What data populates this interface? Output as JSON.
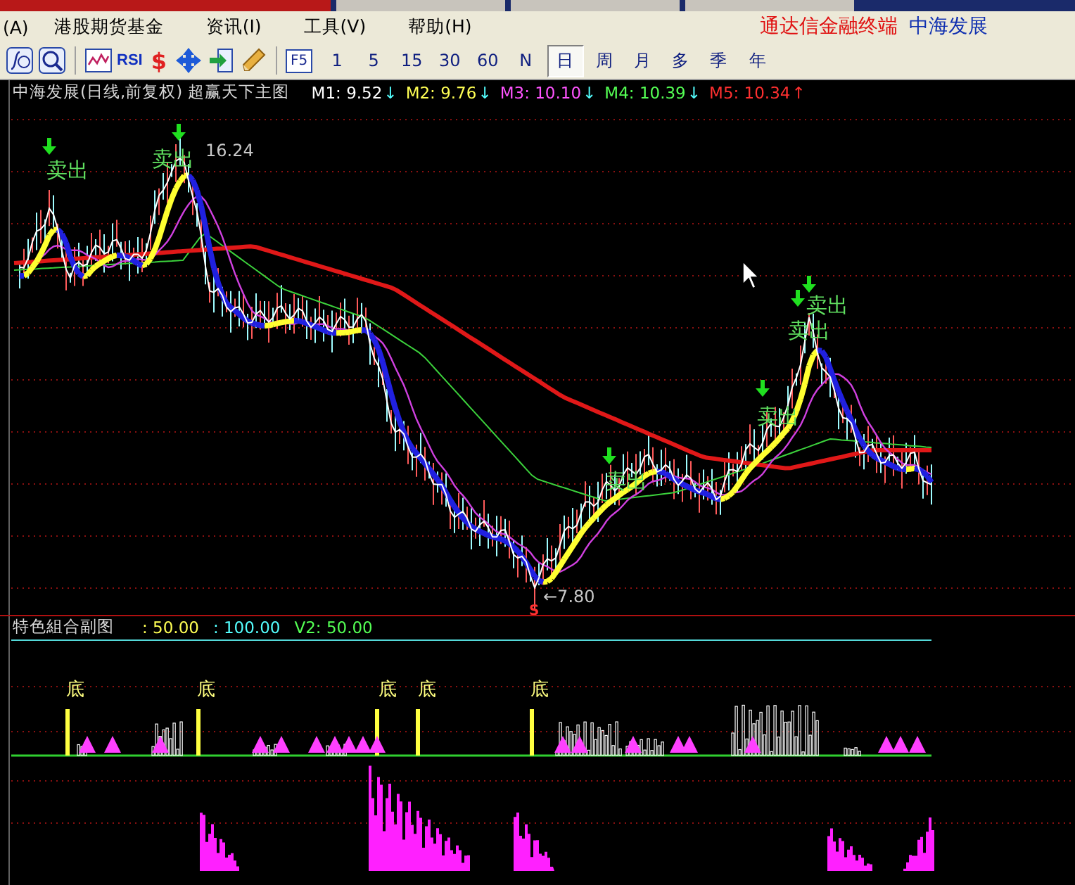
{
  "menu": {
    "items": [
      "(A)",
      "港股期货基金",
      "资讯(I)",
      "工具(V)",
      "帮助(H)"
    ],
    "app_title": "通达信金融终端",
    "stock_name": "中海发展"
  },
  "toolbar": {
    "rsi": "RSI",
    "dollar": "$",
    "f5": "F5",
    "periods": [
      {
        "label": "1",
        "selected": false
      },
      {
        "label": "5",
        "selected": false
      },
      {
        "label": "15",
        "selected": false
      },
      {
        "label": "30",
        "selected": false
      },
      {
        "label": "60",
        "selected": false
      },
      {
        "label": "N",
        "selected": false
      },
      {
        "label": "日",
        "selected": true
      },
      {
        "label": "周",
        "selected": false
      },
      {
        "label": "月",
        "selected": false
      },
      {
        "label": "多",
        "selected": false
      },
      {
        "label": "季",
        "selected": false
      },
      {
        "label": "年",
        "selected": false
      }
    ]
  },
  "main_chart": {
    "title": "中海发展(日线,前复权) 超赢天下主图",
    "averages": [
      {
        "label": "M1: 9.52",
        "color": "#ffffff",
        "arrow": {
          "text": "↓",
          "color": "#54ffff"
        }
      },
      {
        "label": "M2: 9.76",
        "color": "#ffff54",
        "arrow": {
          "text": "↓",
          "color": "#54ffff"
        }
      },
      {
        "label": "M3: 10.10",
        "color": "#ff54ff",
        "arrow": {
          "text": "↓",
          "color": "#54ffff"
        }
      },
      {
        "label": "M4: 10.39",
        "color": "#54ff54",
        "arrow": {
          "text": "↓",
          "color": "#54ffff"
        }
      },
      {
        "label": "M5: 10.34",
        "color": "#ff3030",
        "arrow": {
          "text": "↑",
          "color": "#ff3030"
        }
      }
    ],
    "signals": [
      "卖出",
      "卖出",
      "卖出",
      "卖出",
      "卖出",
      "卖出"
    ],
    "high_label": "16.24",
    "low_label": "←7.80",
    "low_marker": "S"
  },
  "sub_chart": {
    "title": "特色組合副图",
    "values": [
      {
        "label": ": 50.00",
        "color": "#ffff54"
      },
      {
        "label": ": 100.00",
        "color": "#54ffff"
      },
      {
        "label": "V2: 50.00",
        "color": "#54ff54"
      }
    ],
    "bottom_labels": [
      "底",
      "底",
      "底",
      "底",
      "底"
    ]
  }
}
